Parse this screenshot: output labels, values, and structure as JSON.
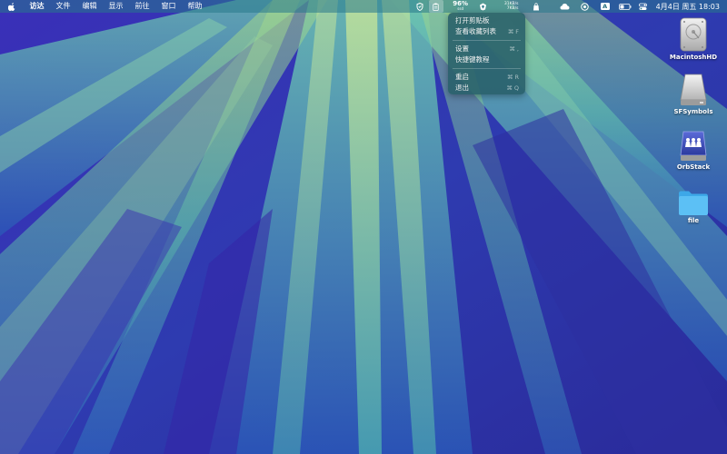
{
  "menubar": {
    "app_menus": [
      "访达",
      "文件",
      "编辑",
      "显示",
      "前往",
      "窗口",
      "帮助"
    ],
    "battery_percent": "96%",
    "battery_sublabel": "ssd",
    "net_up": "31KB/s",
    "net_down": "7KB/s",
    "input_method": "A",
    "clock": "4月4日 周五  18:03"
  },
  "dropdown": {
    "items": [
      {
        "label": "打开剪贴板",
        "shortcut": ""
      },
      {
        "label": "查看收藏列表",
        "shortcut": "⌘ F"
      },
      {
        "label": "设置",
        "shortcut": "⌘ ,"
      },
      {
        "label": "快捷键教程",
        "shortcut": ""
      },
      {
        "label": "重启",
        "shortcut": "⌘ R"
      },
      {
        "label": "退出",
        "shortcut": "⌘ Q"
      }
    ]
  },
  "desktop_icons": [
    {
      "label": "MacintoshHD",
      "icon": "hard-drive-icon"
    },
    {
      "label": "SFSymbols",
      "icon": "drive-icon"
    },
    {
      "label": "OrbStack",
      "icon": "orbstack-icon"
    },
    {
      "label": "file",
      "icon": "folder-icon"
    }
  ]
}
